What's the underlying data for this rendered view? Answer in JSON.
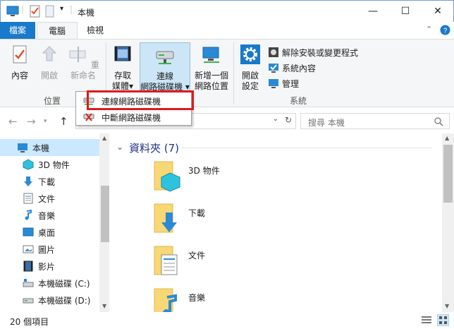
{
  "window": {
    "title": "本機",
    "minimize": "—",
    "maximize": "☐",
    "close": "✕"
  },
  "tabs": {
    "file": "檔案",
    "computer": "電腦",
    "view": "檢視"
  },
  "ribbon": {
    "location": {
      "label": "位置",
      "properties": "內容",
      "open": "開啟",
      "rename": "重新命名"
    },
    "network": {
      "access_media_line1": "存取",
      "access_media_line2": "媒體▾",
      "map_drive_line1": "連線",
      "map_drive_line2": "網路磁碟機 ▾",
      "add_location_line1": "新增一個",
      "add_location_line2": "網路位置"
    },
    "system": {
      "label": "系統",
      "open_settings_line1": "開啟",
      "open_settings_line2": "設定",
      "uninstall": "解除安裝或變更程式",
      "system_properties": "系統內容",
      "manage": "管理"
    }
  },
  "dropdown": {
    "map_network_drive": "連線網路磁碟機",
    "disconnect_network_drive": "中斷網路磁碟機"
  },
  "search": {
    "placeholder": "搜尋 本機"
  },
  "sidebar": {
    "items": [
      {
        "label": "本機"
      },
      {
        "label": "3D 物件"
      },
      {
        "label": "下載"
      },
      {
        "label": "文件"
      },
      {
        "label": "音樂"
      },
      {
        "label": "桌面"
      },
      {
        "label": "圖片"
      },
      {
        "label": "影片"
      },
      {
        "label": "本機磁碟 (C:)"
      },
      {
        "label": "本機磁碟 (D:)"
      }
    ]
  },
  "content": {
    "group_header": "資料夾 (7)",
    "folders": [
      {
        "label": "3D 物件"
      },
      {
        "label": "下載"
      },
      {
        "label": "文件"
      },
      {
        "label": "音樂"
      }
    ]
  },
  "status": {
    "item_count": "20 個項目"
  },
  "colors": {
    "accent": "#1979ca",
    "highlight": "#e0191e",
    "folder": "#f8d775",
    "selected": "#cce8ff"
  }
}
